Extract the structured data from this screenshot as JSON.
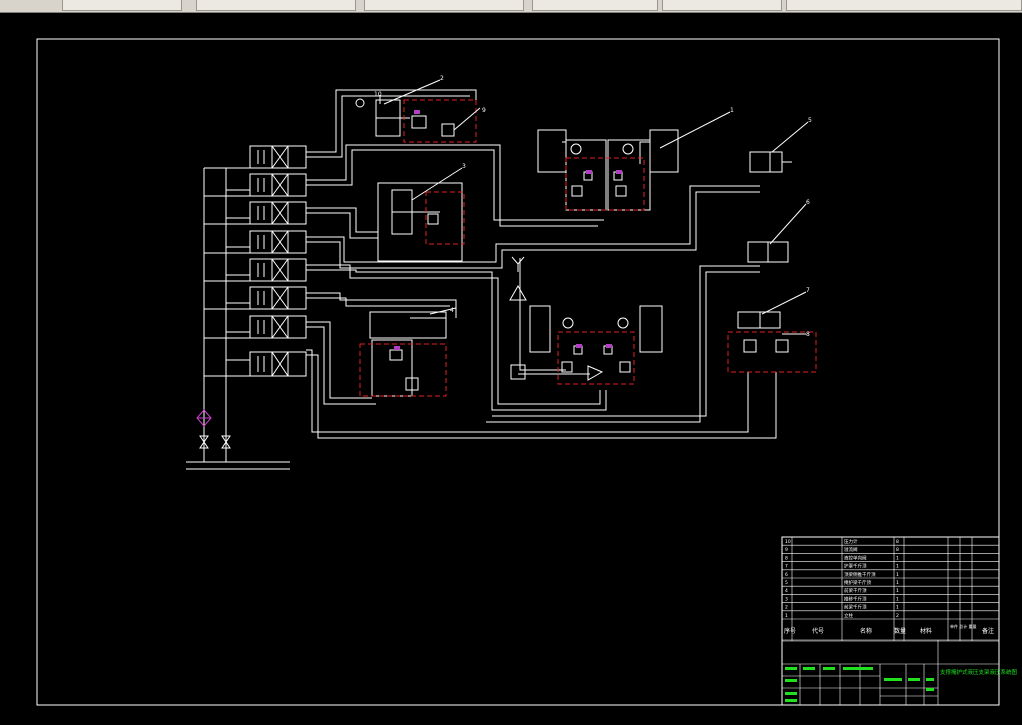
{
  "window": {
    "taskbar_buttons": [
      "",
      "",
      "",
      "",
      "",
      ""
    ]
  },
  "drawing": {
    "component_labels": [
      "1",
      "2",
      "3",
      "4",
      "5",
      "6",
      "7",
      "8",
      "9",
      "10"
    ],
    "title_block": {
      "bom_rows": [
        {
          "no": "10",
          "name": "压力计",
          "qty": "8"
        },
        {
          "no": "9",
          "name": "溢流阀",
          "qty": "8"
        },
        {
          "no": "8",
          "name": "液控单向阀",
          "qty": "1"
        },
        {
          "no": "7",
          "name": "护罩千斤顶",
          "qty": "1"
        },
        {
          "no": "6",
          "name": "顶梁侧推千斤顶",
          "qty": "1"
        },
        {
          "no": "5",
          "name": "掩护梁千斤顶",
          "qty": "1"
        },
        {
          "no": "4",
          "name": "前梁千斤顶",
          "qty": "1"
        },
        {
          "no": "3",
          "name": "推移千斤顶",
          "qty": "1"
        },
        {
          "no": "2",
          "name": "前梁千斤顶",
          "qty": "1"
        },
        {
          "no": "1",
          "name": "立柱",
          "qty": "2"
        }
      ],
      "header": {
        "seq": "序号",
        "code": "代号",
        "name": "名称",
        "qty": "数量",
        "material": "材料",
        "weight": "单件 总计 重量",
        "note": "备注"
      },
      "drawing_title": "支撑掩护式液压支架液压系统图"
    }
  }
}
